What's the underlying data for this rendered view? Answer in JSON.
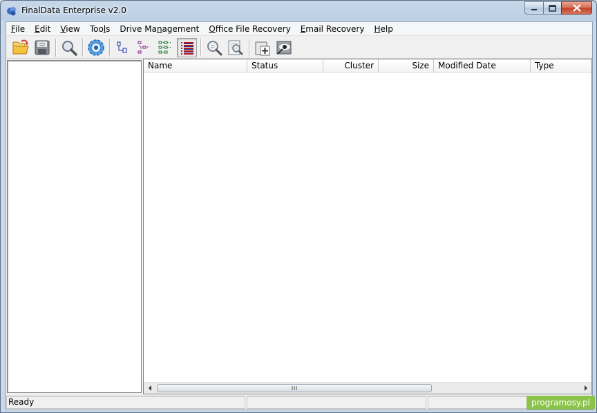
{
  "window": {
    "title": "FinalData Enterprise v2.0"
  },
  "menu": [
    {
      "label_mn": "F",
      "label_rest": "ile",
      "name": "menu-file"
    },
    {
      "label_mn": "E",
      "label_rest": "dit",
      "name": "menu-edit"
    },
    {
      "label_mn": "V",
      "label_rest": "iew",
      "name": "menu-view"
    },
    {
      "label_pre": "Too",
      "label_mn": "l",
      "label_rest": "s",
      "name": "menu-tools"
    },
    {
      "label_pre": "Drive Ma",
      "label_mn": "n",
      "label_rest": "agement",
      "name": "menu-drive-management"
    },
    {
      "label_mn": "O",
      "label_rest": "ffice File Recovery",
      "name": "menu-office-file-recovery"
    },
    {
      "label_mn": "E",
      "label_rest": "mail Recovery",
      "name": "menu-email-recovery"
    },
    {
      "label_mn": "H",
      "label_rest": "elp",
      "name": "menu-help"
    }
  ],
  "toolbar_icons": [
    "open-folder-icon",
    "save-icon",
    "find-icon",
    "settings-gear-icon",
    "view-tree-small-icon",
    "view-tree-medium-icon",
    "view-tree-large-icon",
    "view-details-icon",
    "search-file-icon",
    "search-advanced-icon",
    "add-drive-icon",
    "preview-icon"
  ],
  "list": {
    "columns": [
      "Name",
      "Status",
      "Cluster",
      "Size",
      "Modified Date",
      "Type"
    ]
  },
  "status": {
    "text": "Ready"
  },
  "watermark": "programosy.pl",
  "colors": {
    "window_frame": "#bcd0e6",
    "close_button": "#c24128",
    "watermark": "#8bc34a"
  }
}
